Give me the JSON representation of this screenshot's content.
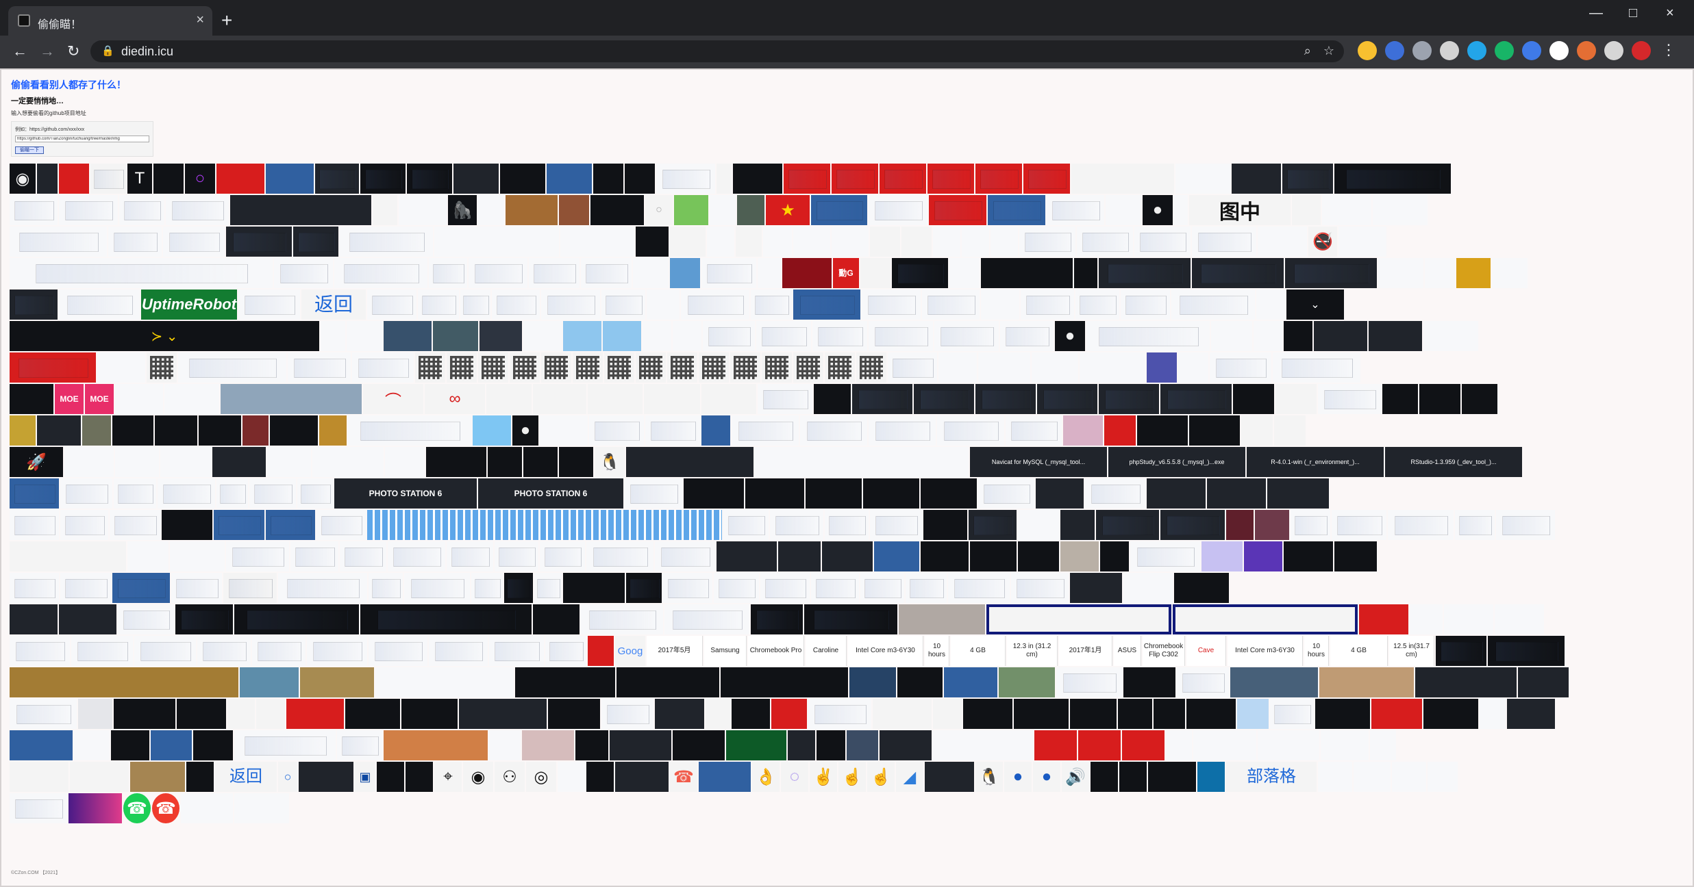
{
  "browser": {
    "tab_title": "偷偷瞄！",
    "url": "diedin.icu"
  },
  "page": {
    "title": "偷偷看看别人都存了什么！",
    "subtitle": "一定要悄悄地…",
    "small_text": "输入想要偷看的github项目地址",
    "form_label": "例如：https://github.com/xxx/xxx",
    "input_value": "https://github.com/TianZonglin/tuchuang/tree/master/img",
    "button_label": "偷瞄一下",
    "footer": "©CZon.COM 【2021】"
  },
  "tiles": {
    "uptime": "UptimeRobot",
    "back1": "返回",
    "back2": "返回",
    "g_text": "勳G",
    "moe1": "MOE",
    "moe2": "MOE",
    "photo1": "PHOTO STATION 6",
    "photo2": "PHOTO STATION 6",
    "navicat": "Navicat for MySQL (_mysql_tool...",
    "phpstudy": "phpStudy_v6.5.5.8 (_mysql_)...exe",
    "r_env": "R-4.0.1-win (_r_environment_)...",
    "rstudio": "RStudio-1.3.959 (_dev_tool_)...",
    "tab_2017_5": "2017年5月",
    "samsung": "Samsung",
    "chromebook_pro": "Chromebook Pro",
    "caroline": "Caroline",
    "core1": "Intel Core m3-6Y30",
    "hours1": "10 hours",
    "ram1": "4 GB",
    "size1": "12.3 in (31.2 cm)",
    "tab_2017_1": "2017年1月",
    "asus": "ASUS",
    "chromebook_flip": "Chromebook Flip C302",
    "cave": "Cave",
    "core2": "Intel Core m3-6Y30",
    "hours2": "10 hours",
    "ram2": "4 GB",
    "size2": "12.5 in(31.7 cm)",
    "tuzhong": "图中",
    "blog": "部落格"
  }
}
